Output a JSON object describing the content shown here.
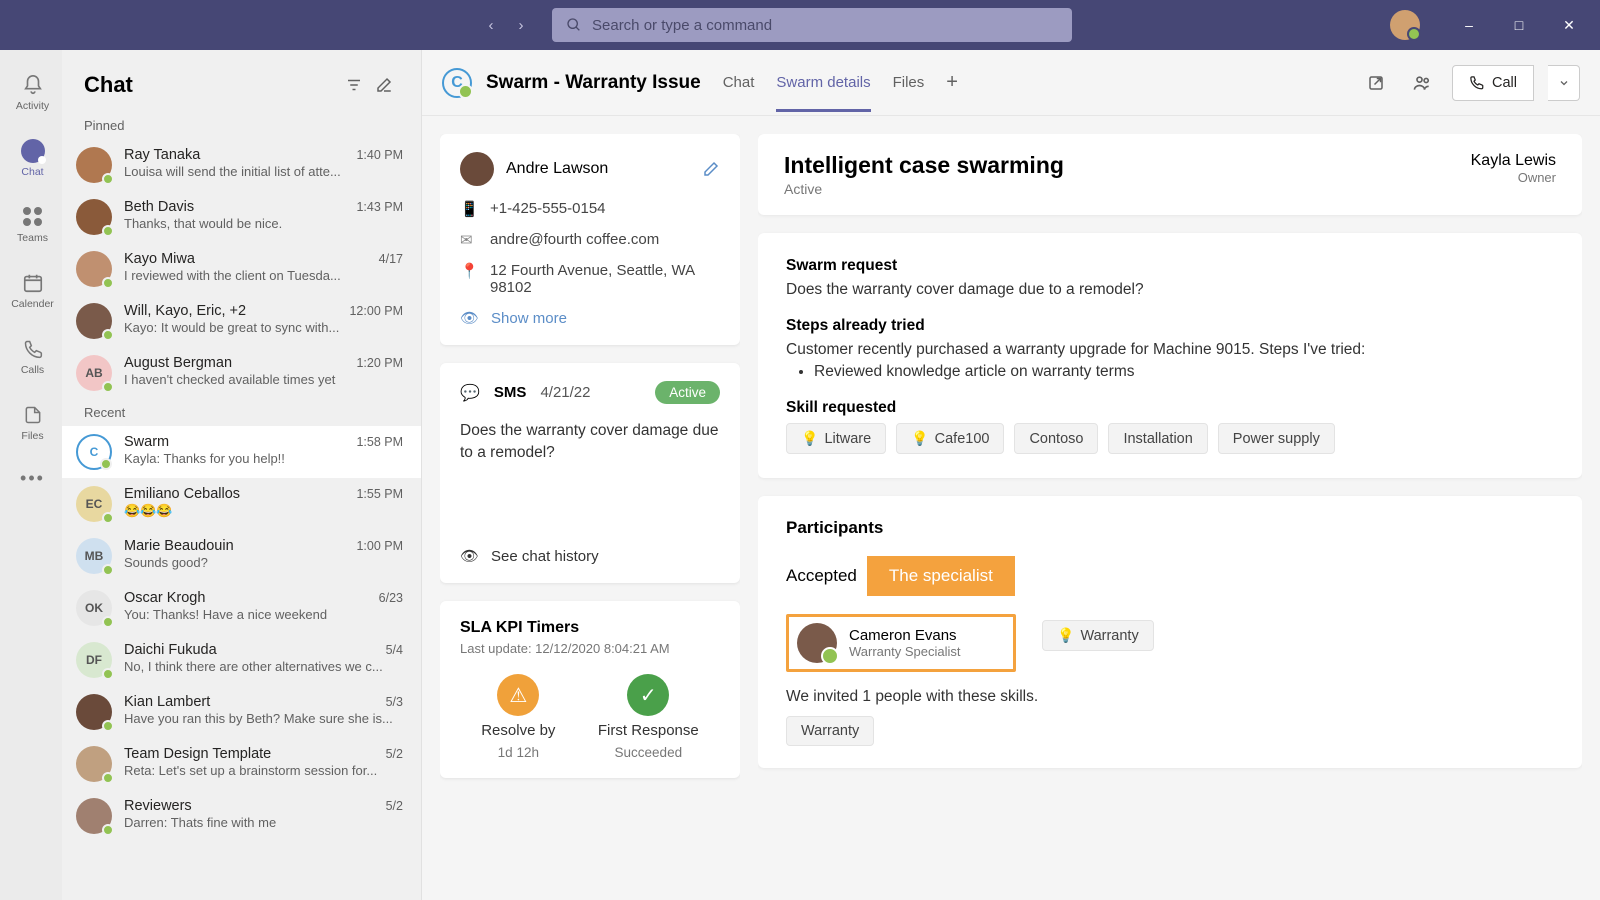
{
  "searchPlaceholder": "Search or type a command",
  "rail": [
    {
      "id": "activity",
      "label": "Activity"
    },
    {
      "id": "chat",
      "label": "Chat"
    },
    {
      "id": "teams",
      "label": "Teams"
    },
    {
      "id": "calendar",
      "label": "Calender"
    },
    {
      "id": "calls",
      "label": "Calls"
    },
    {
      "id": "files",
      "label": "Files"
    }
  ],
  "chatList": {
    "title": "Chat",
    "sections": {
      "pinned": "Pinned",
      "recent": "Recent"
    },
    "pinned": [
      {
        "name": "Ray Tanaka",
        "time": "1:40 PM",
        "preview": "Louisa will send the initial list of atte...",
        "avatar": {
          "bg": "#b07850"
        }
      },
      {
        "name": "Beth Davis",
        "time": "1:43 PM",
        "preview": "Thanks, that would be nice.",
        "avatar": {
          "bg": "#8a5a3a"
        }
      },
      {
        "name": "Kayo Miwa",
        "time": "4/17",
        "preview": "I reviewed with the client on Tuesda...",
        "avatar": {
          "bg": "#c09070"
        }
      },
      {
        "name": "Will, Kayo, Eric, +2",
        "time": "12:00 PM",
        "preview": "Kayo: It would be great to sync with...",
        "avatar": {
          "bg": "#7a5a4a"
        }
      },
      {
        "name": "August Bergman",
        "time": "1:20 PM",
        "preview": "I haven't checked available times yet",
        "avatar": {
          "bg": "#f2c6c6",
          "text": "AB"
        }
      }
    ],
    "recent": [
      {
        "name": "Swarm",
        "time": "1:58 PM",
        "preview": "Kayla: Thanks for you help!!",
        "avatar": {
          "bg": "#fff",
          "ring": "#4599d5",
          "text": "C"
        },
        "selected": true
      },
      {
        "name": "Emiliano Ceballos",
        "time": "1:55 PM",
        "preview": "😂😂😂",
        "avatar": {
          "bg": "#e8d8a0",
          "text": "EC"
        }
      },
      {
        "name": "Marie Beaudouin",
        "time": "1:00 PM",
        "preview": "Sounds good?",
        "avatar": {
          "bg": "#cfe0ef",
          "text": "MB"
        }
      },
      {
        "name": "Oscar Krogh",
        "time": "6/23",
        "preview": "You: Thanks! Have a nice weekend",
        "avatar": {
          "bg": "#e6e6e6",
          "text": "OK"
        }
      },
      {
        "name": "Daichi Fukuda",
        "time": "5/4",
        "preview": "No, I think there are other alternatives we c...",
        "avatar": {
          "bg": "#d8e8d0",
          "text": "DF"
        }
      },
      {
        "name": "Kian Lambert",
        "time": "5/3",
        "preview": "Have you ran this by Beth? Make sure she is...",
        "avatar": {
          "bg": "#6a4a3a"
        }
      },
      {
        "name": "Team Design Template",
        "time": "5/2",
        "preview": "Reta: Let's set up a brainstorm session for...",
        "avatar": {
          "bg": "#c0a080"
        }
      },
      {
        "name": "Reviewers",
        "time": "5/2",
        "preview": "Darren: Thats fine with me",
        "avatar": {
          "bg": "#a08070"
        }
      }
    ]
  },
  "conversation": {
    "title": "Swarm - Warranty Issue",
    "tabs": [
      "Chat",
      "Swarm details",
      "Files"
    ],
    "activeTab": 1,
    "callLabel": "Call"
  },
  "contact": {
    "name": "Andre Lawson",
    "phone": "+1-425-555-0154",
    "email": "andre@fourth coffee.com",
    "address": "12 Fourth Avenue, Seattle, WA 98102",
    "showMore": "Show more"
  },
  "sms": {
    "label": "SMS",
    "date": "4/21/22",
    "badge": "Active",
    "body": "Does the warranty cover damage due to a remodel?",
    "history": "See chat history"
  },
  "sla": {
    "title": "SLA KPI Timers",
    "updated": "Last update: 12/12/2020 8:04:21 AM",
    "items": [
      {
        "name": "Resolve by",
        "value": "1d 12h",
        "state": "warn"
      },
      {
        "name": "First Response",
        "value": "Succeeded",
        "state": "ok"
      }
    ]
  },
  "swarm": {
    "title": "Intelligent case swarming",
    "status": "Active",
    "owner": {
      "name": "Kayla Lewis",
      "role": "Owner"
    },
    "request": {
      "heading": "Swarm request",
      "body": "Does the warranty cover damage due to a remodel?"
    },
    "steps": {
      "heading": "Steps already tried",
      "intro": "Customer recently purchased a warranty upgrade for Machine 9015. Steps I've tried:",
      "bullets": [
        "Reviewed knowledge article on warranty terms"
      ]
    },
    "skills": {
      "heading": "Skill requested",
      "items": [
        {
          "t": "Litware",
          "b": true
        },
        {
          "t": "Cafe100",
          "b": true
        },
        {
          "t": "Contoso",
          "b": false
        },
        {
          "t": "Installation",
          "b": false
        },
        {
          "t": "Power supply",
          "b": false
        }
      ]
    }
  },
  "participants": {
    "heading": "Participants",
    "acceptedLabel": "Accepted",
    "specialistTag": "The specialist",
    "person": {
      "name": "Cameron Evans",
      "role": "Warranty Specialist"
    },
    "sideSkill": "Warranty",
    "invitedLine": "We invited 1 people with these skills.",
    "bottomSkill": "Warranty"
  }
}
